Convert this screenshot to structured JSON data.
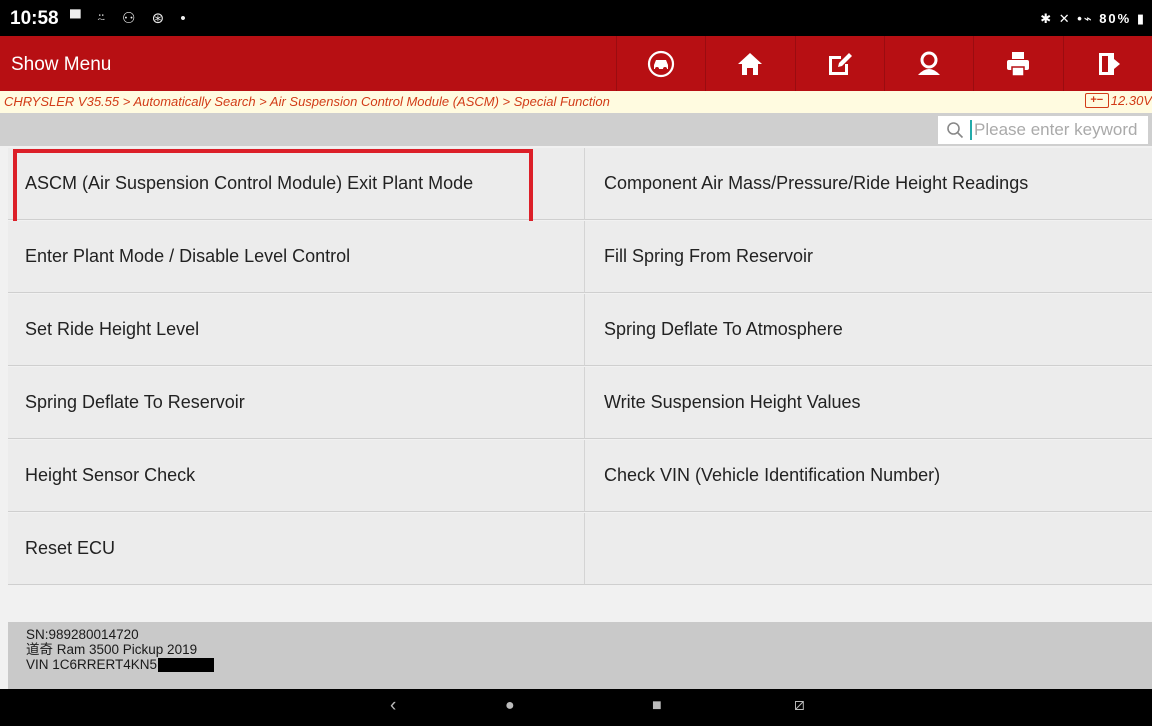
{
  "status_bar": {
    "time": "10:58",
    "notification_icons": "▀ ⍨ ⚇ ⊛ •",
    "right_icons": "✱ ✕ •⌁ 80% ▮"
  },
  "header": {
    "title": "Show Menu",
    "toolbar": [
      {
        "name": "vehicle-icon",
        "label": "Vehicle"
      },
      {
        "name": "home-icon",
        "label": "Home"
      },
      {
        "name": "edit-icon",
        "label": "Edit"
      },
      {
        "name": "user-icon",
        "label": "User"
      },
      {
        "name": "print-icon",
        "label": "Print"
      },
      {
        "name": "exit-icon",
        "label": "Exit"
      }
    ]
  },
  "breadcrumb": {
    "path": "CHRYSLER V35.55 > Automatically Search > Air Suspension Control Module (ASCM) > Special Function",
    "battery_icon": "+−",
    "voltage": "12.30V"
  },
  "search": {
    "placeholder": "Please enter keyword"
  },
  "functions": [
    [
      "ASCM (Air Suspension Control Module) Exit Plant Mode",
      "Component Air Mass/Pressure/Ride Height Readings"
    ],
    [
      "Enter Plant Mode / Disable Level Control",
      "Fill Spring From Reservoir"
    ],
    [
      "Set Ride Height Level",
      "Spring Deflate To Atmosphere"
    ],
    [
      "Spring Deflate To Reservoir",
      "Write Suspension Height Values"
    ],
    [
      "Height Sensor Check",
      "Check VIN (Vehicle Identification Number)"
    ],
    [
      "Reset ECU",
      ""
    ]
  ],
  "vehicle": {
    "sn": "SN:989280014720",
    "model": "道奇 Ram 3500 Pickup 2019",
    "vin": "VIN 1C6RRERT4KN5"
  },
  "nav_bar": {
    "back": "‹",
    "home": "●",
    "recents": "■",
    "screenshot": "⧄"
  },
  "colors": {
    "title_bar": "#b70f13",
    "breadcrumb_text": "#d23b17",
    "highlight": "#dc1f28"
  }
}
